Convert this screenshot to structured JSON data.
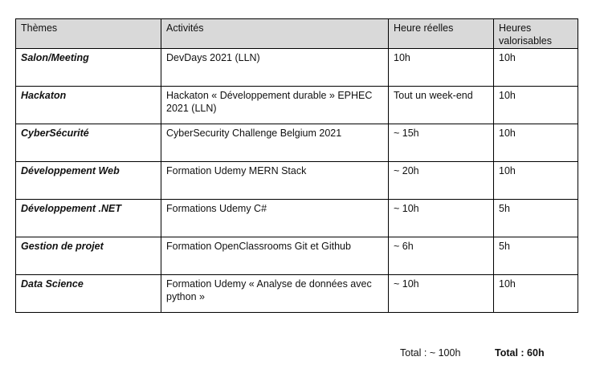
{
  "table": {
    "headers": [
      "Thèmes",
      "Activités",
      "Heure réelles",
      "Heures valorisables"
    ],
    "rows": [
      {
        "theme": "Salon/Meeting",
        "activity": "DevDays 2021 (LLN)",
        "real_hours": "10h",
        "valued_hours": "10h"
      },
      {
        "theme": "Hackaton",
        "activity": "Hackaton « Développement durable » EPHEC 2021 (LLN)",
        "real_hours": "Tout un week-end",
        "valued_hours": "10h"
      },
      {
        "theme": "CyberSécurité",
        "activity": "CyberSecurity Challenge Belgium 2021",
        "real_hours": "~ 15h",
        "valued_hours": "10h"
      },
      {
        "theme": "Développement Web",
        "activity": "Formation Udemy MERN Stack",
        "real_hours": "~ 20h",
        "valued_hours": "10h"
      },
      {
        "theme": "Développement .NET",
        "activity": "Formations Udemy C#",
        "real_hours": "~ 10h",
        "valued_hours": "5h"
      },
      {
        "theme": "Gestion de projet",
        "activity": "Formation OpenClassrooms Git et Github",
        "real_hours": "~ 6h",
        "valued_hours": "5h"
      },
      {
        "theme": "Data Science",
        "activity": "Formation Udemy « Analyse de données avec python »",
        "real_hours": "~ 10h",
        "valued_hours": "10h"
      }
    ]
  },
  "totals": {
    "real": "Total : ~ 100h",
    "valued": "Total : 60h"
  },
  "colors": {
    "header_background": "#d9d9d9",
    "border": "#000000"
  }
}
